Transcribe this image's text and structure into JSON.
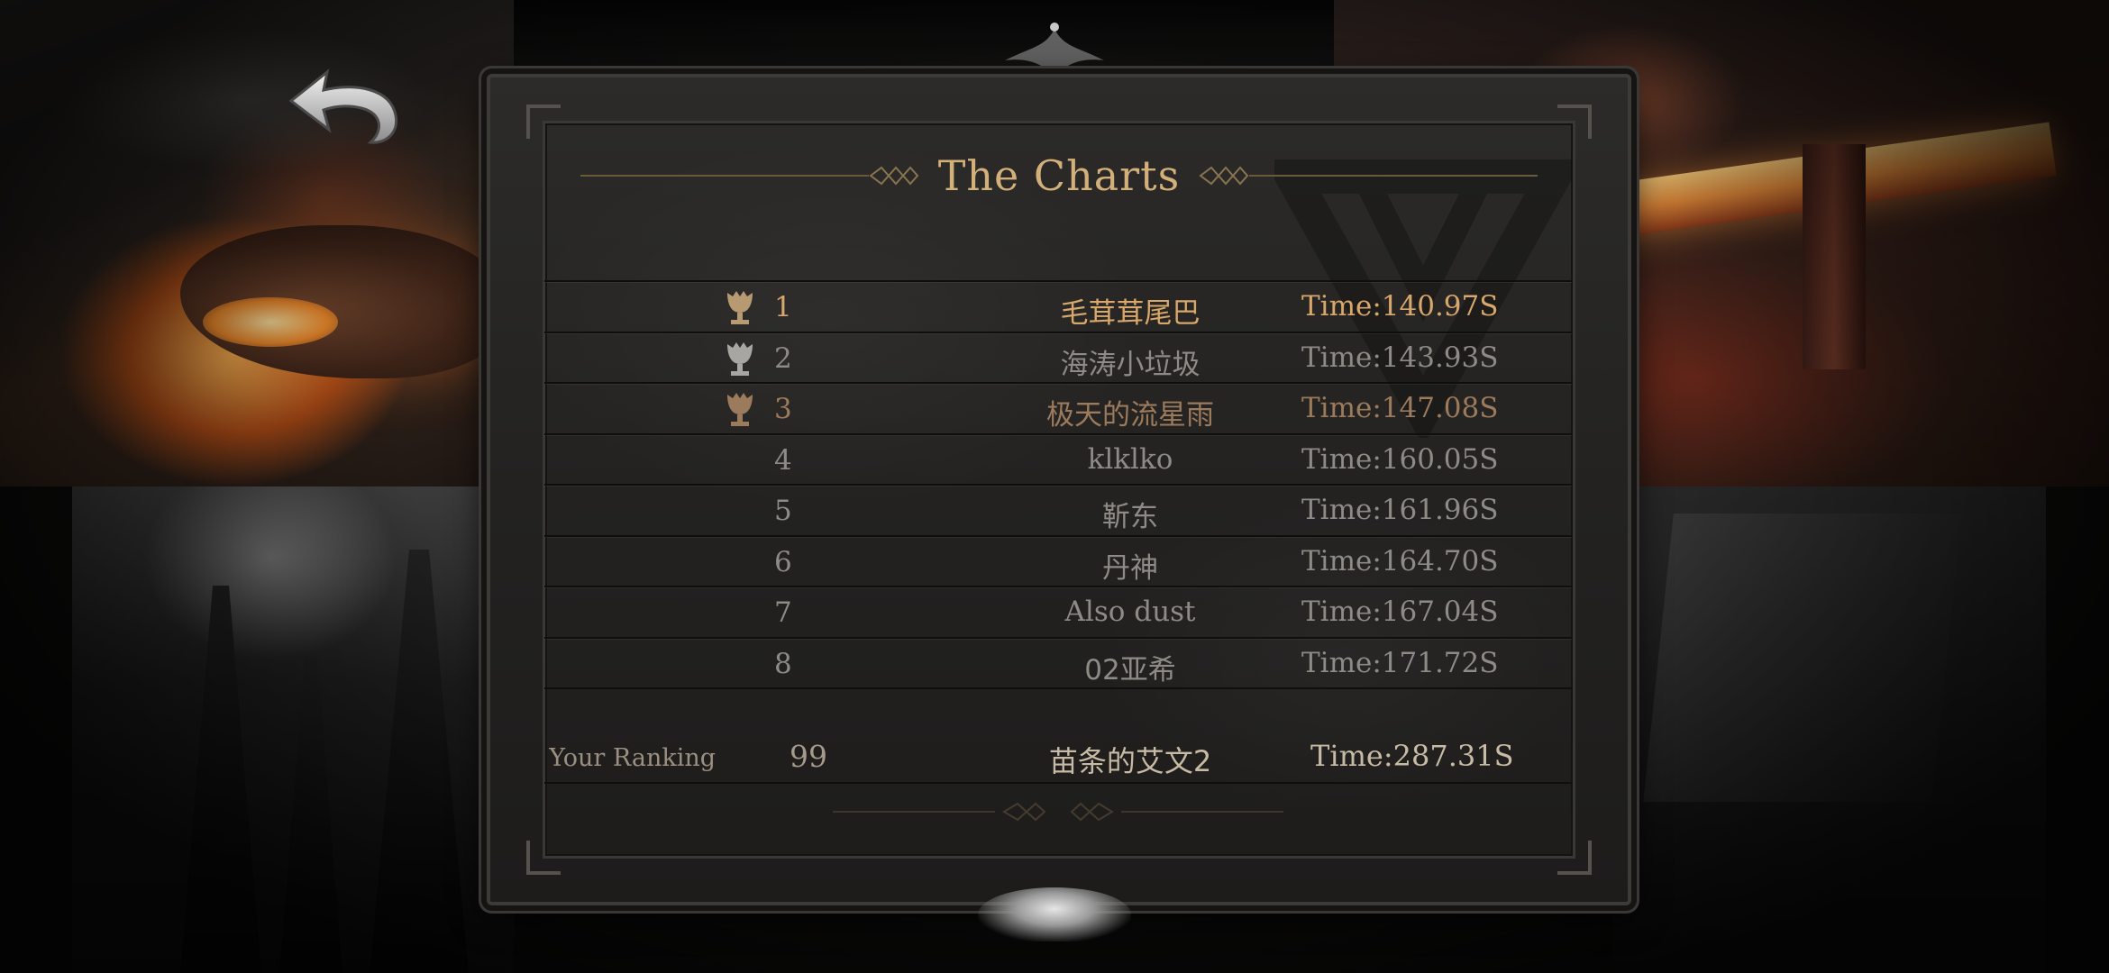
{
  "header": {
    "title": "The Charts"
  },
  "leaderboard": [
    {
      "rank": "1",
      "name": "毛茸茸尾巴",
      "time": "Time:140.97S",
      "trophy": "trophy-icon",
      "color": "#d8a76b"
    },
    {
      "rank": "2",
      "name": "海涛小垃圾",
      "time": "Time:143.93S",
      "trophy": "trophy-icon",
      "color": "#8e8b86"
    },
    {
      "rank": "3",
      "name": "极天的流星雨",
      "time": "Time:147.08S",
      "trophy": "trophy-icon",
      "color": "#9c7a5c"
    },
    {
      "rank": "4",
      "name": "klklko",
      "time": "Time:160.05S"
    },
    {
      "rank": "5",
      "name": "靳东",
      "time": "Time:161.96S"
    },
    {
      "rank": "6",
      "name": "丹神",
      "time": "Time:164.70S"
    },
    {
      "rank": "7",
      "name": "Also dust",
      "time": "Time:167.04S"
    },
    {
      "rank": "8",
      "name": "02亚希",
      "time": "Time:171.72S"
    }
  ],
  "your_ranking": {
    "label": "Your Ranking",
    "rank": "99",
    "name": "苗条的艾文2",
    "time": "Time:287.31S"
  },
  "icons": {
    "back": "back-arrow-icon",
    "watermark": "triangle-emblem-icon",
    "trophy": "trophy-icon"
  },
  "colors": {
    "title": "#d3b07a",
    "gold": "#d8a76b",
    "silver": "#8e8b86",
    "bronze": "#9c7a5c",
    "board": "#252423"
  }
}
